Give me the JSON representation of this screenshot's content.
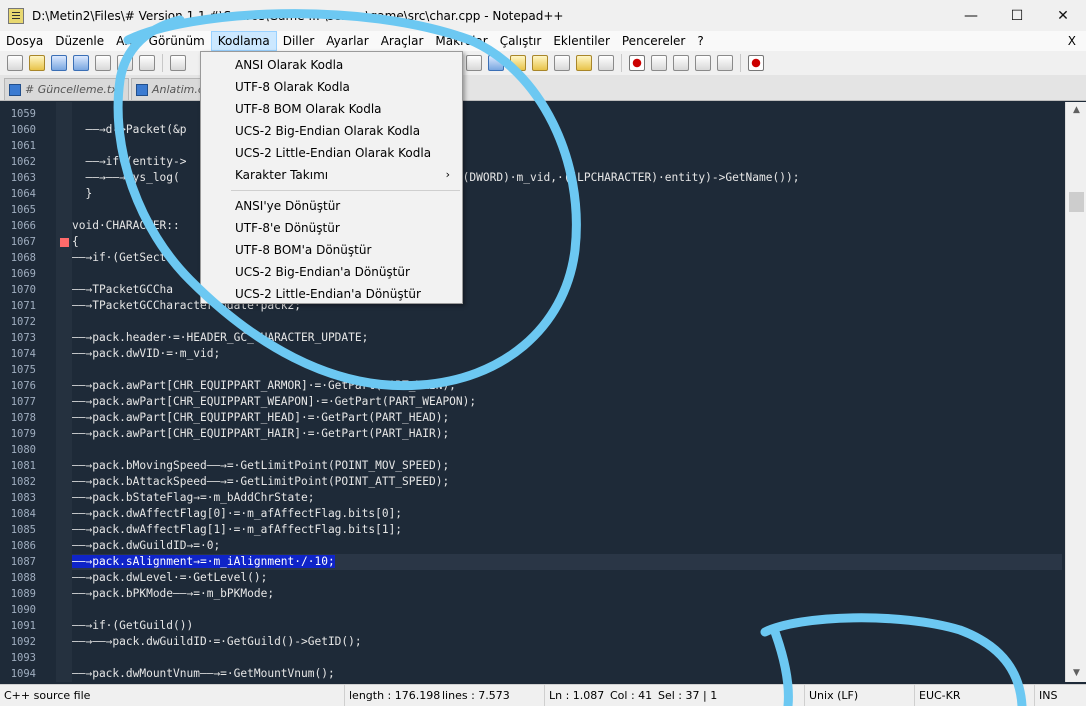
{
  "window": {
    "title": "D:\\Metin2\\Files\\# Version 1.1 #\\Source\\Game ... \\server\\game\\src\\char.cpp - Notepad++",
    "controls": {
      "minimize": "—",
      "maximize": "☐",
      "close": "✕"
    }
  },
  "menu": {
    "items": [
      "Dosya",
      "Düzenle",
      "Ara",
      "Görünüm",
      "Kodlama",
      "Diller",
      "Ayarlar",
      "Araçlar",
      "Makrolar",
      "Çalıştır",
      "Eklentiler",
      "Pencereler",
      "?"
    ],
    "active_index": 4,
    "close_label": "X"
  },
  "tabs": [
    {
      "label": "# Güncelleme.txt"
    },
    {
      "label": "Anlatim.cpp"
    }
  ],
  "encoding_menu": {
    "items": [
      "ANSI Olarak Kodla",
      "UTF-8 Olarak Kodla",
      "UTF-8 BOM Olarak Kodla",
      "UCS-2 Big-Endian Olarak Kodla",
      "UCS-2 Little-Endian Olarak Kodla",
      "Karakter Takımı",
      "ANSI'ye Dönüştür",
      "UTF-8'e Dönüştür",
      "UTF-8 BOM'a Dönüştür",
      "UCS-2 Big-Endian'a Dönüştür",
      "UCS-2 Little-Endian'a Dönüştür"
    ],
    "submenu_arrow": "›"
  },
  "code": {
    "lines": [
      {
        "n": "1059",
        "t": ""
      },
      {
        "n": "1060",
        "t": "  ——→d->Packet(&p                              ete));"
      },
      {
        "n": "1061",
        "t": ""
      },
      {
        "n": "1062",
        "t": "  ——→if·(entity->"
      },
      {
        "n": "1063",
        "t": "  ——→——→sys_log(                              ·GetName(),·(DWORD)·m_vid,·((LPCHARACTER)·entity)->GetName());"
      },
      {
        "n": "1064",
        "t": "  }"
      },
      {
        "n": "1065",
        "t": ""
      },
      {
        "n": "1066",
        "t": "void·CHARACTER::"
      },
      {
        "n": "1067",
        "t": "{"
      },
      {
        "n": "1068",
        "t": "——→if·(GetSectr"
      },
      {
        "n": "1069",
        "t": ""
      },
      {
        "n": "1070",
        "t": "——→TPacketGCCha"
      },
      {
        "n": "1071",
        "t": "——→TPacketGCCharacterUpdate·pack2;"
      },
      {
        "n": "1072",
        "t": ""
      },
      {
        "n": "1073",
        "t": "——→pack.header·=·HEADER_GC_CHARACTER_UPDATE;"
      },
      {
        "n": "1074",
        "t": "——→pack.dwVID·=·m_vid;"
      },
      {
        "n": "1075",
        "t": ""
      },
      {
        "n": "1076",
        "t": "——→pack.awPart[CHR_EQUIPPART_ARMOR]·=·GetPart(PART_MAIN);"
      },
      {
        "n": "1077",
        "t": "——→pack.awPart[CHR_EQUIPPART_WEAPON]·=·GetPart(PART_WEAPON);"
      },
      {
        "n": "1078",
        "t": "——→pack.awPart[CHR_EQUIPPART_HEAD]·=·GetPart(PART_HEAD);"
      },
      {
        "n": "1079",
        "t": "——→pack.awPart[CHR_EQUIPPART_HAIR]·=·GetPart(PART_HAIR);"
      },
      {
        "n": "1080",
        "t": ""
      },
      {
        "n": "1081",
        "t": "——→pack.bMovingSpeed——→=·GetLimitPoint(POINT_MOV_SPEED);"
      },
      {
        "n": "1082",
        "t": "——→pack.bAttackSpeed——→=·GetLimitPoint(POINT_ATT_SPEED);"
      },
      {
        "n": "1083",
        "t": "——→pack.bStateFlag→=·m_bAddChrState;"
      },
      {
        "n": "1084",
        "t": "——→pack.dwAffectFlag[0]·=·m_afAffectFlag.bits[0];"
      },
      {
        "n": "1085",
        "t": "——→pack.dwAffectFlag[1]·=·m_afAffectFlag.bits[1];"
      },
      {
        "n": "1086",
        "t": "——→pack.dwGuildID→=·0;"
      },
      {
        "n": "1087",
        "t": "——→pack.sAlignment→=·m_iAlignment·/·10;"
      },
      {
        "n": "1088",
        "t": "——→pack.dwLevel·=·GetLevel();"
      },
      {
        "n": "1089",
        "t": "——→pack.bPKMode——→=·m_bPKMode;"
      },
      {
        "n": "1090",
        "t": ""
      },
      {
        "n": "1091",
        "t": "——→if·(GetGuild())"
      },
      {
        "n": "1092",
        "t": "——→——→pack.dwGuildID·=·GetGuild()->GetID();"
      },
      {
        "n": "1093",
        "t": ""
      },
      {
        "n": "1094",
        "t": "——→pack.dwMountVnum——→=·GetMountVnum();"
      }
    ],
    "highlight_line": "1087"
  },
  "status": {
    "language": "C++ source file",
    "length": "length : 176.198",
    "lines": "lines : 7.573",
    "ln": "Ln : 1.087",
    "col": "Col : 41",
    "sel": "Sel : 37 | 1",
    "eol": "Unix (LF)",
    "encoding": "EUC-KR",
    "mode": "INS"
  },
  "colors": {
    "editor_bg": "#1e2a38",
    "selection": "#0f24c8",
    "marker": "#6cc8f2",
    "fold_marker": "#ff6b6b"
  }
}
